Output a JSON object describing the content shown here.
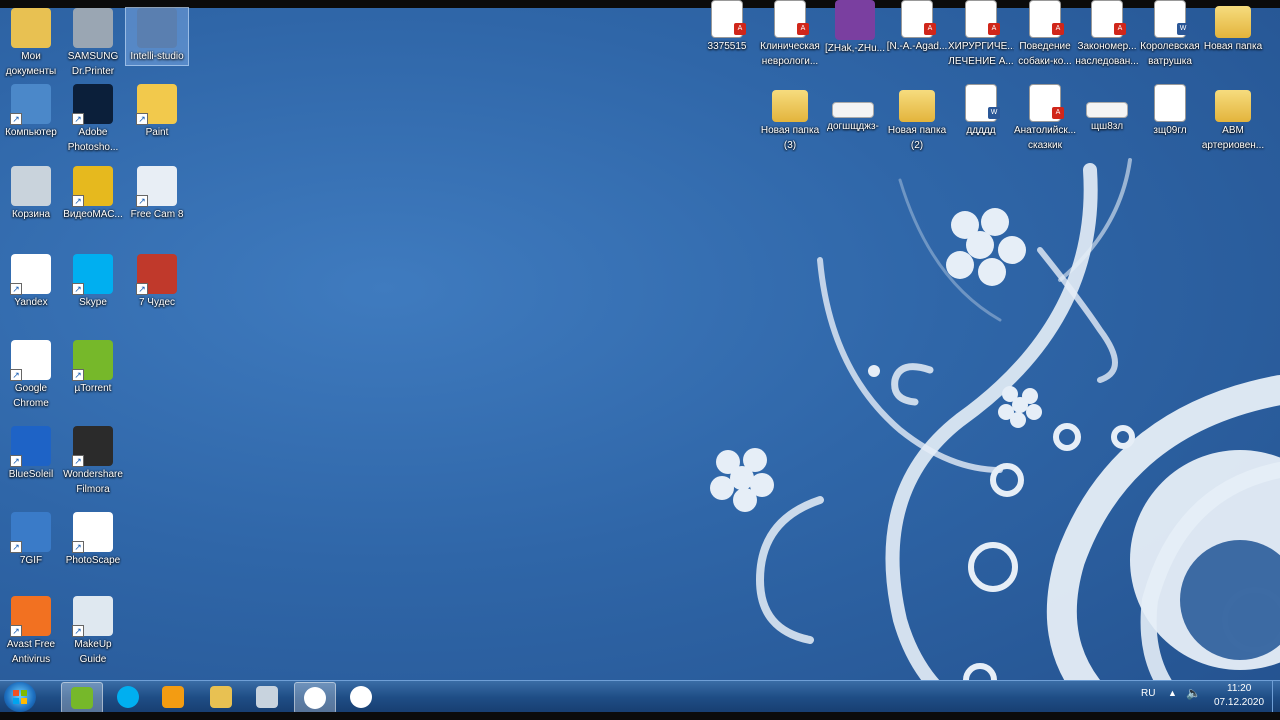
{
  "desktop_icons_left": [
    {
      "label1": "Мои",
      "label2": "документы",
      "icon": "folder-docs-icon",
      "color": "#e8c152"
    },
    {
      "label1": "SAMSUNG",
      "label2": "Dr.Printer",
      "icon": "printer-icon",
      "color": "#9aa6b3"
    },
    {
      "label1": "Intelli-studio",
      "label2": "",
      "icon": "intelli-studio-icon",
      "color": "#5a7fb0"
    },
    {
      "label1": "Компьютер",
      "label2": "",
      "icon": "computer-icon",
      "color": "#4b88c9"
    },
    {
      "label1": "Adobe",
      "label2": "Photosho...",
      "icon": "photoshop-icon",
      "color": "#0b1f3a"
    },
    {
      "label1": "Paint",
      "label2": "",
      "icon": "paint-icon",
      "color": "#f2c94c"
    },
    {
      "label1": "Корзина",
      "label2": "",
      "icon": "recycle-bin-icon",
      "color": "#c9d3dc"
    },
    {
      "label1": "ВидеоМАС...",
      "label2": "",
      "icon": "videomaster-icon",
      "color": "#e6b91e"
    },
    {
      "label1": "Free Cam 8",
      "label2": "",
      "icon": "freecam-icon",
      "color": "#e8eef5"
    },
    {
      "label1": "Yandex",
      "label2": "",
      "icon": "yandex-browser-icon",
      "color": "#ffffff"
    },
    {
      "label1": "Skype",
      "label2": "",
      "icon": "skype-icon",
      "color": "#00aff0"
    },
    {
      "label1": "7 Чудес",
      "label2": "",
      "icon": "seven-wonders-icon",
      "color": "#c0392b"
    },
    {
      "label1": "Google",
      "label2": "Chrome",
      "icon": "chrome-icon",
      "color": "#ffffff"
    },
    {
      "label1": "µTorrent",
      "label2": "",
      "icon": "utorrent-icon",
      "color": "#76b82a"
    },
    {
      "label1": "BlueSoleil",
      "label2": "",
      "icon": "bluetooth-icon",
      "color": "#1e63c6"
    },
    {
      "label1": "Wondershare",
      "label2": "Filmora",
      "icon": "filmora-icon",
      "color": "#2b2b2b"
    },
    {
      "label1": "7GIF",
      "label2": "",
      "icon": "7gif-icon",
      "color": "#3a7bc8"
    },
    {
      "label1": "PhotoScape",
      "label2": "",
      "icon": "photoscape-icon",
      "color": "#ffffff"
    },
    {
      "label1": "Avast Free",
      "label2": "Antivirus",
      "icon": "avast-icon",
      "color": "#f27121"
    },
    {
      "label1": "MakeUp",
      "label2": "Guide",
      "icon": "makeup-guide-icon",
      "color": "#dfe8f0"
    }
  ],
  "desktop_icons_right_row1": [
    {
      "label1": "3375515",
      "label2": "",
      "type": "pdf"
    },
    {
      "label1": "Клиническая",
      "label2": "неврологи...",
      "type": "pdf"
    },
    {
      "label1": "[ZHak,-ZHu...",
      "label2": "",
      "type": "book"
    },
    {
      "label1": "[N.-A.-Agad...",
      "label2": "",
      "type": "pdf"
    },
    {
      "label1": "ХИРУРГИЧЕ...",
      "label2": "ЛЕЧЕНИЕ А...",
      "type": "pdf"
    },
    {
      "label1": "Поведение",
      "label2": "собаки-ко...",
      "type": "pdf"
    },
    {
      "label1": "Закономер...",
      "label2": "наследован...",
      "type": "pdf"
    },
    {
      "label1": "Королевская",
      "label2": "ватрушка",
      "type": "word"
    },
    {
      "label1": "Новая папка",
      "label2": "",
      "type": "folder"
    }
  ],
  "desktop_icons_right_row2": [
    {
      "label1": "Новая папка",
      "label2": "(3)",
      "type": "folder"
    },
    {
      "label1": "догшщджз-",
      "label2": "",
      "type": "image"
    },
    {
      "label1": "Новая папка",
      "label2": "(2)",
      "type": "folder"
    },
    {
      "label1": "ддддд",
      "label2": "",
      "type": "word"
    },
    {
      "label1": "Анатолийск...",
      "label2": "сказкик",
      "type": "pdf"
    },
    {
      "label1": "щш8зл",
      "label2": "",
      "type": "image"
    },
    {
      "label1": "зщ09гл",
      "label2": "",
      "type": "doc"
    },
    {
      "label1": "АВМ",
      "label2": "артериовен...",
      "type": "folder"
    }
  ],
  "taskbar": {
    "items": [
      {
        "name": "utorrent-taskbar-icon",
        "color": "#76b82a",
        "active": true
      },
      {
        "name": "skype-taskbar-icon",
        "color": "#00aff0",
        "active": false
      },
      {
        "name": "media-player-taskbar-icon",
        "color": "#f39c12",
        "active": false
      },
      {
        "name": "explorer-taskbar-icon",
        "color": "#e8c152",
        "active": false
      },
      {
        "name": "keyboard-taskbar-icon",
        "color": "#c8d3de",
        "active": false
      },
      {
        "name": "yandex-taskbar-icon",
        "color": "#ffffff",
        "active": true
      },
      {
        "name": "chrome-taskbar-icon",
        "color": "#ffffff",
        "active": false
      }
    ],
    "language": "RU",
    "time": "11:20",
    "date": "07.12.2020"
  }
}
